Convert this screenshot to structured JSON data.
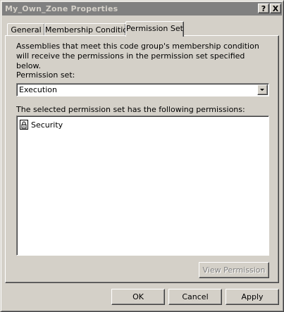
{
  "window": {
    "title": "My_Own_Zone Properties",
    "help_label": "?",
    "close_label": "X"
  },
  "tabs": [
    {
      "label": "General",
      "selected": false
    },
    {
      "label": "Membership Condition",
      "selected": false
    },
    {
      "label": "Permission Set",
      "selected": true
    }
  ],
  "panel": {
    "description": "Assemblies that meet this code group's membership condition will receive the permissions in the permission set specified below.",
    "permission_set_label": "Permission set:",
    "permission_set_value": "Execution",
    "permissions_label": "The selected permission set has the following permissions:",
    "permissions": [
      {
        "label": "Security",
        "icon": "lock-document-icon"
      }
    ],
    "view_permission_label": "View Permission",
    "view_permission_enabled": false
  },
  "buttons": {
    "ok": "OK",
    "cancel": "Cancel",
    "apply": "Apply"
  }
}
